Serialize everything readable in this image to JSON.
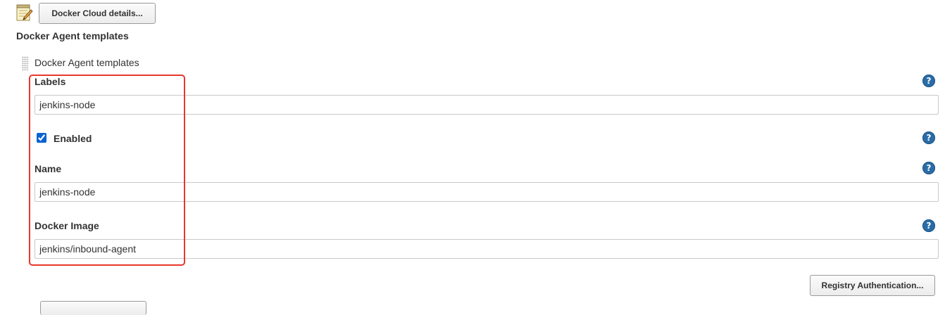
{
  "header": {
    "cloud_details_label": "Docker Cloud details..."
  },
  "section": {
    "title": "Docker Agent templates"
  },
  "template": {
    "header": "Docker Agent templates",
    "fields": {
      "labels": {
        "label": "Labels",
        "value": "jenkins-node"
      },
      "enabled": {
        "label": "Enabled",
        "checked": true
      },
      "name": {
        "label": "Name",
        "value": "jenkins-node"
      },
      "docker_image": {
        "label": "Docker Image",
        "value": "jenkins/inbound-agent"
      }
    },
    "help_icon": "?",
    "registry_auth_label": "Registry Authentication..."
  },
  "icons": {
    "notepad": "notepad-icon",
    "drag_handle": "drag-handle-icon",
    "help": "help-icon"
  },
  "colors": {
    "highlight": "#e8372c",
    "help_icon": "#2a6ca6",
    "checkbox": "#0a63d1"
  }
}
